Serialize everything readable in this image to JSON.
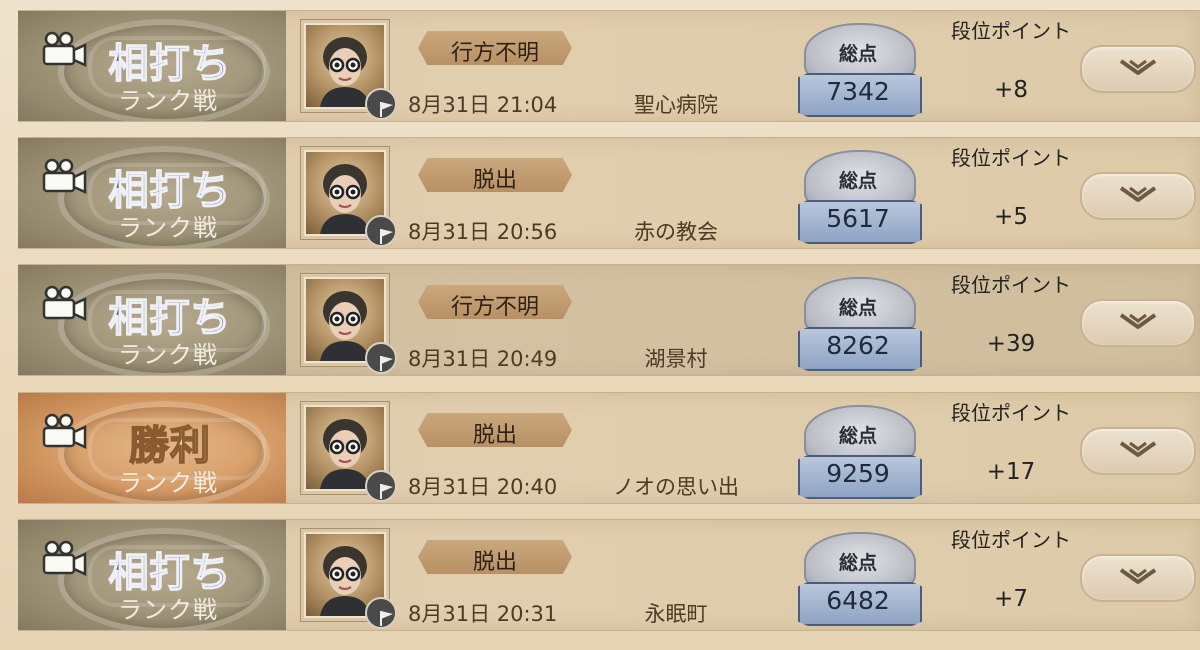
{
  "labels": {
    "total_score": "総点",
    "rank_points": "段位ポイント",
    "mode": "ランク戦"
  },
  "matches": [
    {
      "result": "相打ち",
      "result_type": "draw",
      "status": "行方不明",
      "datetime": "8月31日 21:04",
      "map": "聖心病院",
      "score": "7342",
      "points": "+8"
    },
    {
      "result": "相打ち",
      "result_type": "draw",
      "status": "脱出",
      "datetime": "8月31日 20:56",
      "map": "赤の教会",
      "score": "5617",
      "points": "+5"
    },
    {
      "result": "相打ち",
      "result_type": "draw",
      "status": "行方不明",
      "datetime": "8月31日 20:49",
      "map": "湖景村",
      "score": "8262",
      "points": "+39"
    },
    {
      "result": "勝利",
      "result_type": "win",
      "status": "脱出",
      "datetime": "8月31日 20:40",
      "map": "ノオの思い出",
      "score": "9259",
      "points": "+17"
    },
    {
      "result": "相打ち",
      "result_type": "draw",
      "status": "脱出",
      "datetime": "8月31日 20:31",
      "map": "永眠町",
      "score": "6482",
      "points": "+7"
    }
  ],
  "colors": {
    "draw_badge": "#9e9276",
    "win_badge": "#d59a64",
    "score_ribbon": "#8ea3c4"
  },
  "icons": [
    "video-camera-icon",
    "flag-icon",
    "chevron-down-icon"
  ]
}
